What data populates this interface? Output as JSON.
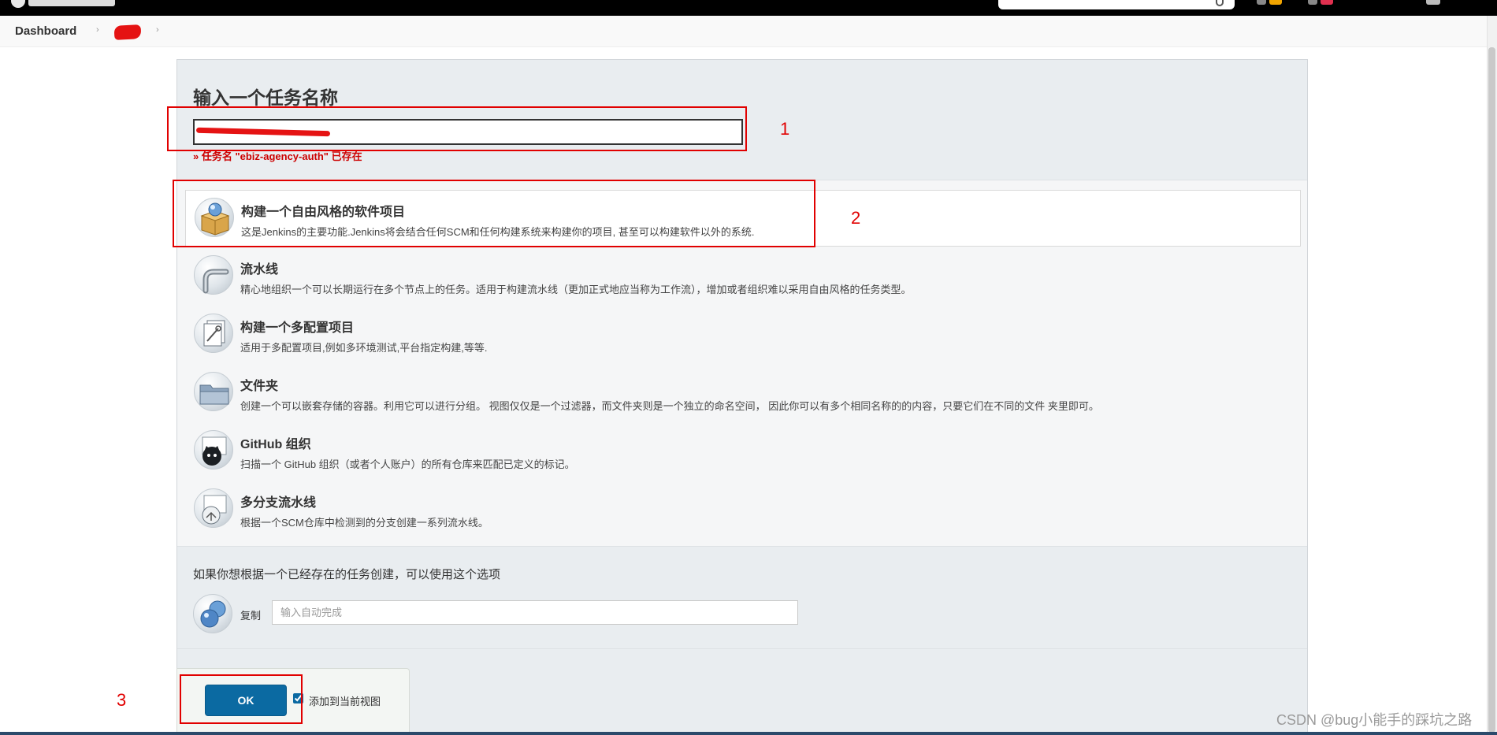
{
  "breadcrumb": {
    "items": [
      "Dashboard"
    ]
  },
  "new_item": {
    "title": "输入一个任务名称",
    "name_input_value": "",
    "error_message": "» 任务名 \"ebiz-agency-auth\" 已存在"
  },
  "item_types": [
    {
      "name": "构建一个自由风格的软件项目",
      "description": "这是Jenkins的主要功能.Jenkins将会结合任何SCM和任何构建系统来构建你的项目, 甚至可以构建软件以外的系统.",
      "icon": "freestyle-box-icon",
      "selected": true
    },
    {
      "name": "流水线",
      "description": "精心地组织一个可以长期运行在多个节点上的任务。适用于构建流水线（更加正式地应当称为工作流），增加或者组织难以采用自由风格的任务类型。",
      "icon": "pipeline-icon",
      "selected": false
    },
    {
      "name": "构建一个多配置项目",
      "description": "适用于多配置项目,例如多环境测试,平台指定构建,等等.",
      "icon": "multi-config-icon",
      "selected": false
    },
    {
      "name": "文件夹",
      "description": "创建一个可以嵌套存储的容器。利用它可以进行分组。 视图仅仅是一个过滤器，而文件夹则是一个独立的命名空间， 因此你可以有多个相同名称的的内容，只要它们在不同的文件 夹里即可。",
      "icon": "folder-icon",
      "selected": false
    },
    {
      "name": "GitHub 组织",
      "description": "扫描一个 GitHub 组织（或者个人账户）的所有仓库来匹配已定义的标记。",
      "icon": "github-octocat-icon",
      "selected": false
    },
    {
      "name": "多分支流水线",
      "description": "根据一个SCM仓库中检测到的分支创建一系列流水线。",
      "icon": "multibranch-icon",
      "selected": false
    }
  ],
  "copy_section": {
    "title": "如果你想根据一个已经存在的任务创建，可以使用这个选项",
    "label": "复制",
    "input_placeholder": "输入自动完成",
    "icon": "copy-icon"
  },
  "footer": {
    "ok_label": "OK",
    "add_to_view_label": "添加到当前视图",
    "add_to_view_checked": true
  },
  "annotations": [
    "1",
    "2",
    "3"
  ],
  "watermark": "CSDN @bug小能手的踩坑之路",
  "colors": {
    "ok_button": "#0b6aa2",
    "annotation": "#e10000",
    "error": "#cc0000",
    "panel_bg": "#e9edf0"
  }
}
